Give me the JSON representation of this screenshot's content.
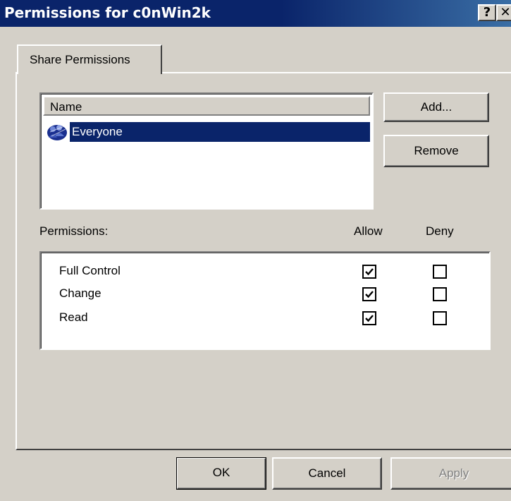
{
  "window": {
    "title": "Permissions for c0nWin2k",
    "help_label": "?",
    "close_label": "✕"
  },
  "tabs": [
    {
      "label": "Share Permissions",
      "active": true
    }
  ],
  "name_list": {
    "column_header": "Name",
    "items": [
      {
        "label": "Everyone",
        "icon": "group-users-icon",
        "selected": true
      }
    ]
  },
  "buttons": {
    "add": "Add...",
    "remove": "Remove",
    "ok": "OK",
    "cancel": "Cancel",
    "apply": "Apply"
  },
  "permissions": {
    "heading": "Permissions:",
    "allow_header": "Allow",
    "deny_header": "Deny",
    "rows": [
      {
        "name": "Full Control",
        "allow": true,
        "deny": false
      },
      {
        "name": "Change",
        "allow": true,
        "deny": false
      },
      {
        "name": "Read",
        "allow": true,
        "deny": false
      }
    ]
  },
  "colors": {
    "title_bar": "#0a246a",
    "selection": "#0a246a",
    "dialog_face": "#d4d0c8"
  }
}
